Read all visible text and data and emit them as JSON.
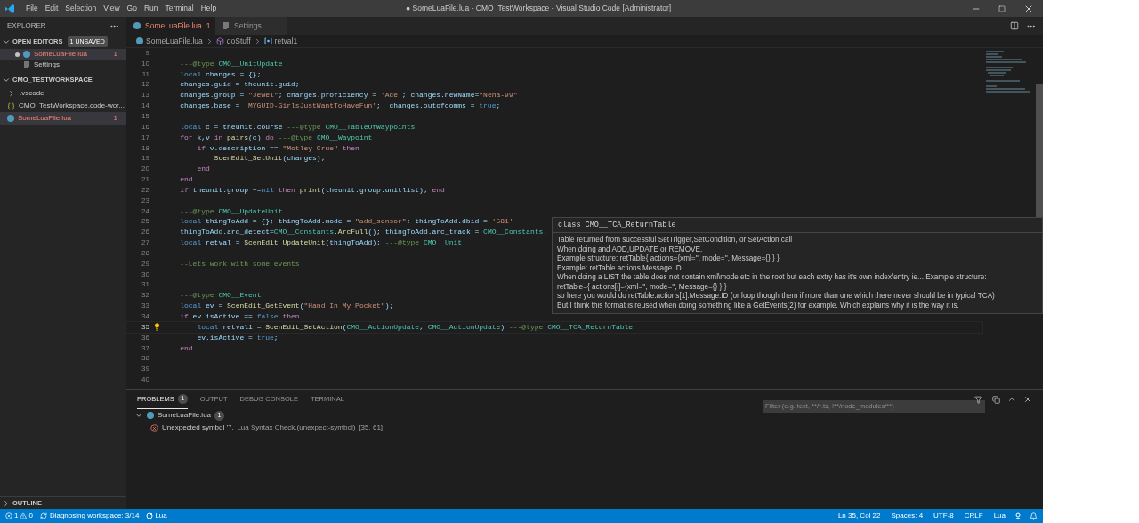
{
  "window": {
    "title": "● SomeLuaFile.lua - CMO_TestWorkspace - Visual Studio Code [Administrator]"
  },
  "menu": [
    "File",
    "Edit",
    "Selection",
    "View",
    "Go",
    "Run",
    "Terminal",
    "Help"
  ],
  "sidebar": {
    "title": "EXPLORER",
    "open_editors": {
      "label": "OPEN EDITORS",
      "badge": "1 UNSAVED",
      "expanded": true,
      "items": [
        {
          "label": "SomeLuaFile.lua",
          "kind": "lua",
          "unsaved": true,
          "selected": true,
          "count": "1"
        },
        {
          "label": "Settings",
          "kind": "settings",
          "unsaved": false,
          "selected": false
        }
      ]
    },
    "workspace": {
      "label": "CMO_TESTWORKSPACE",
      "expanded": true,
      "items": [
        {
          "label": ".vscode",
          "kind": "folder",
          "selected": false
        },
        {
          "label": "CMO_TestWorkspace.code-wor...",
          "kind": "json",
          "selected": false
        },
        {
          "label": "SomeLuaFile.lua",
          "kind": "lua",
          "selected": true,
          "count": "1"
        }
      ]
    },
    "outline": {
      "label": "OUTLINE",
      "expanded": false
    }
  },
  "tabs": [
    {
      "label": "SomeLuaFile.lua",
      "kind": "lua",
      "badge": "1",
      "unsaved": true,
      "selected": true
    },
    {
      "label": "Settings",
      "kind": "settings",
      "unsaved": false,
      "selected": false
    }
  ],
  "breadcrumbs": [
    {
      "label": "SomeLuaFile.lua",
      "kind": "lua"
    },
    {
      "label": "doStuff",
      "kind": "function"
    },
    {
      "label": "retval1",
      "kind": "variable"
    }
  ],
  "code_lines": [
    {
      "number": "9",
      "current": false
    },
    {
      "number": "10",
      "current": false,
      "tokens": [
        {
          "kind": "cm",
          "text": "    ---@type "
        },
        {
          "kind": "ty",
          "text": "CMO__UnitUpdate"
        }
      ]
    },
    {
      "number": "11",
      "current": false,
      "tokens": [
        {
          "kind": "decl",
          "text": "    local"
        },
        {
          "kind": "id",
          "text": " changes = {};"
        }
      ]
    },
    {
      "number": "12",
      "current": false,
      "tokens": [
        {
          "kind": "id",
          "text": "    changes.guid = theunit.guid;"
        }
      ]
    },
    {
      "number": "13",
      "current": false,
      "tokens": [
        {
          "kind": "id",
          "text": "    changes.group = "
        },
        {
          "kind": "str",
          "text": "\"Jewel\""
        },
        {
          "kind": "id",
          "text": "; changes.proficiency = "
        },
        {
          "kind": "str",
          "text": "'Ace'"
        },
        {
          "kind": "id",
          "text": "; changes.newName="
        },
        {
          "kind": "str",
          "text": "\"Nena-99\""
        }
      ]
    },
    {
      "number": "14",
      "current": false,
      "tokens": [
        {
          "kind": "id",
          "text": "    changes.base = "
        },
        {
          "kind": "str",
          "text": "'MYGUID-GirlsJustWantToHaveFun'"
        },
        {
          "kind": "id",
          "text": ";  changes.outofcomms = "
        },
        {
          "kind": "decl",
          "text": "true"
        },
        {
          "kind": "id",
          "text": ";"
        }
      ]
    },
    {
      "number": "15",
      "current": false
    },
    {
      "number": "16",
      "current": false,
      "tokens": [
        {
          "kind": "decl",
          "text": "    local"
        },
        {
          "kind": "id",
          "text": " c = theunit.course "
        },
        {
          "kind": "cm",
          "text": "---@type "
        },
        {
          "kind": "ty",
          "text": "CMO__TableOfWaypoints"
        }
      ]
    },
    {
      "number": "17",
      "current": false,
      "tokens": [
        {
          "kind": "kw",
          "text": "    for"
        },
        {
          "kind": "id",
          "text": " k,v "
        },
        {
          "kind": "kw",
          "text": "in"
        },
        {
          "kind": "fn",
          "text": " pairs"
        },
        {
          "kind": "id",
          "text": "(c) "
        },
        {
          "kind": "kw",
          "text": "do"
        },
        {
          "kind": "cm",
          "text": " ---@type "
        },
        {
          "kind": "ty",
          "text": "CMO__Waypoint"
        }
      ]
    },
    {
      "number": "18",
      "current": false,
      "tokens": [
        {
          "kind": "kw",
          "text": "        if"
        },
        {
          "kind": "id",
          "text": " v.description == "
        },
        {
          "kind": "str",
          "text": "\"Motley Crue\""
        },
        {
          "kind": "kw",
          "text": " then"
        }
      ]
    },
    {
      "number": "19",
      "current": false,
      "tokens": [
        {
          "kind": "fn",
          "text": "            ScenEdit_SetUnit"
        },
        {
          "kind": "id",
          "text": "(changes);"
        }
      ]
    },
    {
      "number": "20",
      "current": false,
      "tokens": [
        {
          "kind": "kw",
          "text": "        end"
        }
      ]
    },
    {
      "number": "21",
      "current": false,
      "tokens": [
        {
          "kind": "kw",
          "text": "    end"
        }
      ]
    },
    {
      "number": "22",
      "current": false,
      "tokens": [
        {
          "kind": "kw",
          "text": "    if"
        },
        {
          "kind": "id",
          "text": " theunit.group ~="
        },
        {
          "kind": "decl",
          "text": "nil"
        },
        {
          "kind": "kw",
          "text": " then"
        },
        {
          "kind": "fn",
          "text": " print"
        },
        {
          "kind": "id",
          "text": "(theunit.group.unitlist); "
        },
        {
          "kind": "kw",
          "text": "end"
        }
      ]
    },
    {
      "number": "23",
      "current": false
    },
    {
      "number": "24",
      "current": false,
      "tokens": [
        {
          "kind": "cm",
          "text": "    ---@type "
        },
        {
          "kind": "ty",
          "text": "CMO__UpdateUnit"
        }
      ]
    },
    {
      "number": "25",
      "current": false,
      "tokens": [
        {
          "kind": "decl",
          "text": "    local"
        },
        {
          "kind": "id",
          "text": " thingToAdd = {}; thingToAdd.mode = "
        },
        {
          "kind": "str",
          "text": "\"add_sensor\""
        },
        {
          "kind": "id",
          "text": "; thingToAdd.dbid = "
        },
        {
          "kind": "str",
          "text": "'581'"
        }
      ]
    },
    {
      "number": "26",
      "current": false,
      "tokens": [
        {
          "kind": "id",
          "text": "    thingToAdd.arc_detect="
        },
        {
          "kind": "ty",
          "text": "CMO__Constants"
        },
        {
          "kind": "id",
          "text": "."
        },
        {
          "kind": "fn",
          "text": "ArcFull"
        },
        {
          "kind": "id",
          "text": "(); thingToAdd.arc_track = "
        },
        {
          "kind": "ty",
          "text": "CMO__Constants"
        },
        {
          "kind": "id",
          "text": "."
        }
      ]
    },
    {
      "number": "27",
      "current": false,
      "tokens": [
        {
          "kind": "decl",
          "text": "    local"
        },
        {
          "kind": "id",
          "text": " retval = "
        },
        {
          "kind": "fn",
          "text": "ScenEdit_UpdateUnit"
        },
        {
          "kind": "id",
          "text": "(thingToAdd); "
        },
        {
          "kind": "cm",
          "text": "---@type "
        },
        {
          "kind": "ty",
          "text": "CMO__Unit"
        }
      ]
    },
    {
      "number": "28",
      "current": false
    },
    {
      "number": "29",
      "current": false,
      "tokens": [
        {
          "kind": "cm",
          "text": "    --Lets work with some events"
        }
      ]
    },
    {
      "number": "30",
      "current": false
    },
    {
      "number": "31",
      "current": false
    },
    {
      "number": "32",
      "current": false,
      "tokens": [
        {
          "kind": "cm",
          "text": "    ---@type "
        },
        {
          "kind": "ty",
          "text": "CMO__Event"
        }
      ]
    },
    {
      "number": "33",
      "current": false,
      "tokens": [
        {
          "kind": "decl",
          "text": "    local"
        },
        {
          "kind": "id",
          "text": " ev = "
        },
        {
          "kind": "fn",
          "text": "ScenEdit_GetEvent"
        },
        {
          "kind": "id",
          "text": "("
        },
        {
          "kind": "str",
          "text": "\"Hand In My Pocket\""
        },
        {
          "kind": "id",
          "text": ");"
        }
      ]
    },
    {
      "number": "34",
      "current": false,
      "tokens": [
        {
          "kind": "kw",
          "text": "    if"
        },
        {
          "kind": "id",
          "text": " ev.isActive == "
        },
        {
          "kind": "decl",
          "text": "false"
        },
        {
          "kind": "kw",
          "text": " then"
        }
      ]
    },
    {
      "number": "35",
      "current": true,
      "tokens": [
        {
          "kind": "decl",
          "text": "        local"
        },
        {
          "kind": "id",
          "text": " retval1 = "
        },
        {
          "kind": "fn",
          "text": "ScenEdit_SetAction"
        },
        {
          "kind": "id",
          "text": "("
        },
        {
          "kind": "ty",
          "text": "CMO__ActionUpdate"
        },
        {
          "kind": "id",
          "text": "; "
        },
        {
          "kind": "ty",
          "text": "CMO__ActionUpdate"
        },
        {
          "kind": "id",
          "text": ") "
        },
        {
          "kind": "cm",
          "text": "---@type "
        },
        {
          "kind": "ty",
          "text": "CMO__TCA_ReturnTable"
        }
      ]
    },
    {
      "number": "36",
      "current": false,
      "tokens": [
        {
          "kind": "id",
          "text": "        ev.isActive = "
        },
        {
          "kind": "decl",
          "text": "true"
        },
        {
          "kind": "id",
          "text": ";"
        }
      ]
    },
    {
      "number": "37",
      "current": false,
      "tokens": [
        {
          "kind": "kw",
          "text": "    end"
        }
      ]
    },
    {
      "number": "38",
      "current": false
    },
    {
      "number": "39",
      "current": false
    },
    {
      "number": "40",
      "current": false
    }
  ],
  "hover": {
    "title": "class CMO__TCA_ReturnTable",
    "lines": [
      "Table returned from successful SetTrigger,SetCondition, or SetAction call",
      "When doing and ADD,UPDATE or REMOVE.",
      "Example structure: retTable{ actions={xml='', mode='', Message={} } }",
      "Example: retTable.actions.Message.ID",
      "When doing a LIST the table does not contain xml\\mode etc in the root but each extry has it's own index\\entry ie... Example structure:",
      "retTable={ actions[i]={xml='', mode='', Message={} } }",
      "so here you would do retTable.actions[1].Message.ID (or loop though them if more than one which there never should be in typical TCA)",
      "But I think this format is reused when doing something like a GetEvents(2) for example. Which explains why it is the way it is."
    ]
  },
  "panel": {
    "tabs": [
      {
        "label": "PROBLEMS",
        "badge": "1",
        "selected": true
      },
      {
        "label": "OUTPUT",
        "selected": false
      },
      {
        "label": "DEBUG CONSOLE",
        "selected": false
      },
      {
        "label": "TERMINAL",
        "selected": false
      }
    ],
    "filter": {
      "placeholder": "Filter (e.g. text, **/*.ts, !**/node_modules/**)"
    },
    "groups": [
      {
        "file": "SomeLuaFile.lua",
        "count": "1",
        "expanded": true,
        "problems": [
          {
            "kind": "error",
            "message": "Unexpected symbol '`'.",
            "source": "Lua Syntax Check.(unexpect-symbol)",
            "location": "[35, 61]"
          }
        ]
      }
    ]
  },
  "status_bar": {
    "errors": "1",
    "warnings": "0",
    "task": "Diagnosing workspace: 3/14",
    "language_server": "Lua",
    "right": [
      "Ln 35, Col 22",
      "Spaces: 4",
      "UTF-8",
      "CRLF",
      "Lua"
    ]
  }
}
